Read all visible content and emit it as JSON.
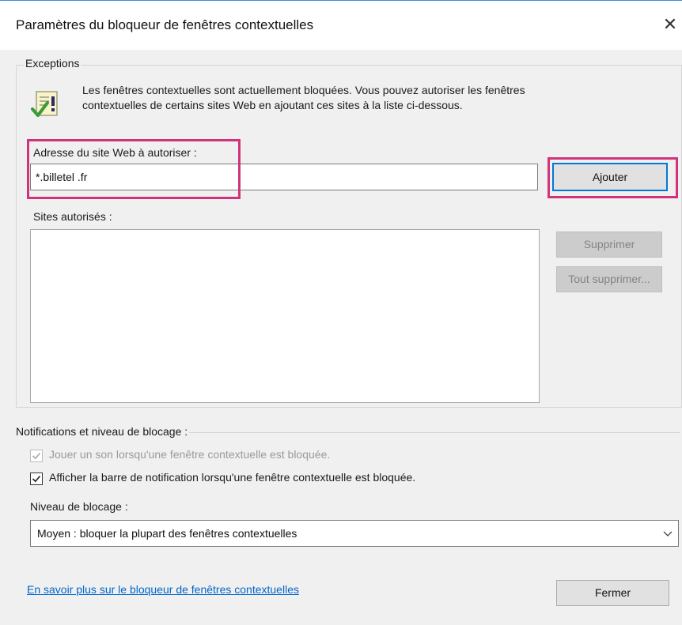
{
  "window": {
    "title": "Paramètres du bloqueur de fenêtres contextuelles",
    "close_glyph": "✕"
  },
  "exceptions": {
    "group_label": "Exceptions",
    "info_line1": "Les fenêtres contextuelles sont actuellement bloquées.  Vous pouvez autoriser les fenêtres",
    "info_line2": "contextuelles de certains sites Web en ajoutant ces sites à la liste ci-dessous.",
    "info_icon": "info-check-icon",
    "address_label": "Adresse du site Web à autoriser :",
    "address_value": "*.billetel  .fr",
    "add_button": "Ajouter",
    "allowed_label": "Sites autorisés :",
    "allowed_sites": [],
    "remove_button": "Supprimer",
    "remove_all_button": "Tout supprimer..."
  },
  "notifications": {
    "group_label": "Notifications et niveau de blocage :",
    "play_sound_label": "Jouer un son lorsqu'une fenêtre contextuelle est bloquée.",
    "play_sound_checked": true,
    "play_sound_disabled": true,
    "show_bar_label": "Afficher la barre de notification lorsqu'une fenêtre contextuelle est bloquée.",
    "show_bar_checked": true,
    "level_label": "Niveau de blocage :",
    "level_value": "Moyen : bloquer la plupart des fenêtres contextuelles"
  },
  "footer": {
    "learn_more_link": "En savoir plus sur le bloqueur de fenêtres contextuelles",
    "close_button": "Fermer"
  },
  "colors": {
    "highlight": "#d1337a",
    "accent": "#0078d7",
    "link": "#0066cc"
  }
}
